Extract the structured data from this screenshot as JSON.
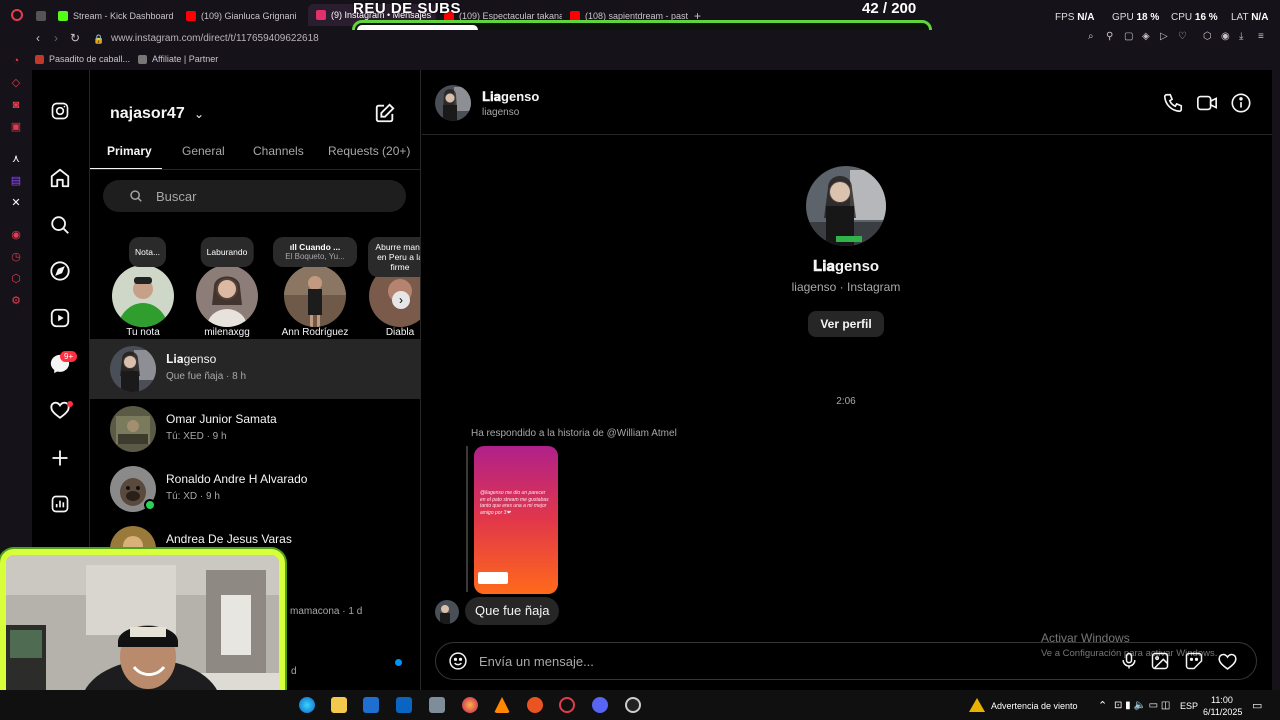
{
  "stream": {
    "title": "REU DE SUBS",
    "progress": 0.21,
    "count": "42",
    "goal": "/ 200",
    "stats": [
      {
        "label": "FPS",
        "value": "N/A"
      },
      {
        "label": "GPU",
        "value": "18 %"
      },
      {
        "label": "CPU",
        "value": "16 %"
      },
      {
        "label": "LAT",
        "value": "N/A"
      }
    ]
  },
  "browser": {
    "tabs": [
      {
        "label": "Stream - Kick Dashboard",
        "color": "#53fc18"
      },
      {
        "label": "(109) Gianluca Grignani",
        "color": "#ff0000"
      },
      {
        "label": "(9) Instagram • Mensajes",
        "color": "#e1306c"
      },
      {
        "label": "(109) Espectacular takana",
        "color": "#ff0000"
      },
      {
        "label": "(108) sapientdream - past",
        "color": "#ff0000"
      }
    ],
    "url": "www.instagram.com/direct/t/117659409622618",
    "bookmarks": [
      "Pasadito de caball...",
      "Affiliate | Partner"
    ]
  },
  "inbox": {
    "account": "najasor47",
    "tabs": [
      "Primary",
      "General",
      "Channels",
      "Requests (20+)"
    ],
    "search_placeholder": "Buscar",
    "notes": [
      {
        "bubble": "Nota...",
        "bubble2": "",
        "name": "Tu nota",
        "color": "#2f9e2f"
      },
      {
        "bubble": "Laburando",
        "bubble2": "",
        "name": "milenaxgg",
        "color": "#b49a8e"
      },
      {
        "bubble": "ıll Cuando ...",
        "bubble2": "El Boqueto, Yu...",
        "name": "Ann Rodríguez",
        "color": "#6f5a4a"
      },
      {
        "bubble": "Aburre mano",
        "bubble2": "en Peru a la firme",
        "name": "Diabla",
        "color": "#7a5a4a"
      }
    ],
    "conversations": [
      {
        "name": "𝐋𝐢𝐚genso",
        "preview": "Que fue ñaja · 8 h",
        "selected": true,
        "online": false,
        "color": "#4a4f57"
      },
      {
        "name": "Omar Junior Samata",
        "preview": "Tú: XED · 9 h",
        "selected": false,
        "online": false,
        "color": "#6b6a52"
      },
      {
        "name": "Ronaldo Andre H Alvarado",
        "preview": "Tú: XD · 9 h",
        "selected": false,
        "online": true,
        "color": "#7f7f7f"
      },
      {
        "name": "Andrea De Jesus Varas",
        "preview": "",
        "selected": false,
        "online": false,
        "color": "#9a7a3a"
      }
    ],
    "partial_preview_1": "mamacona · 1 d",
    "partial_preview_2": "d"
  },
  "chat": {
    "name": "𝐋𝐢𝐚genso",
    "username": "liagenso",
    "profile_sub": "liagenso · Instagram",
    "view_profile": "Ver perfil",
    "timestamp": "2:06",
    "reply_note": "Ha respondido a la historia de @William Atmel",
    "story_text": "@liagenso me dio un parecer en el pato stream me gustabas tanto que eres una a mi mejor amigo por 3❤",
    "message": "Que fue ñaja",
    "composer_placeholder": "Envía un mensaje..."
  },
  "watermark": {
    "line1": "Activar Windows",
    "line2": "Ve a Configuración para activar Windows."
  },
  "taskbar": {
    "weather": "Advertencia de viento",
    "lang": "ESP",
    "time": "11:00",
    "date": "6/11/2025"
  },
  "colors": {
    "instagram_bg": "#000000",
    "accent_green": "#5fd43d",
    "notification_red": "#ff3040"
  }
}
